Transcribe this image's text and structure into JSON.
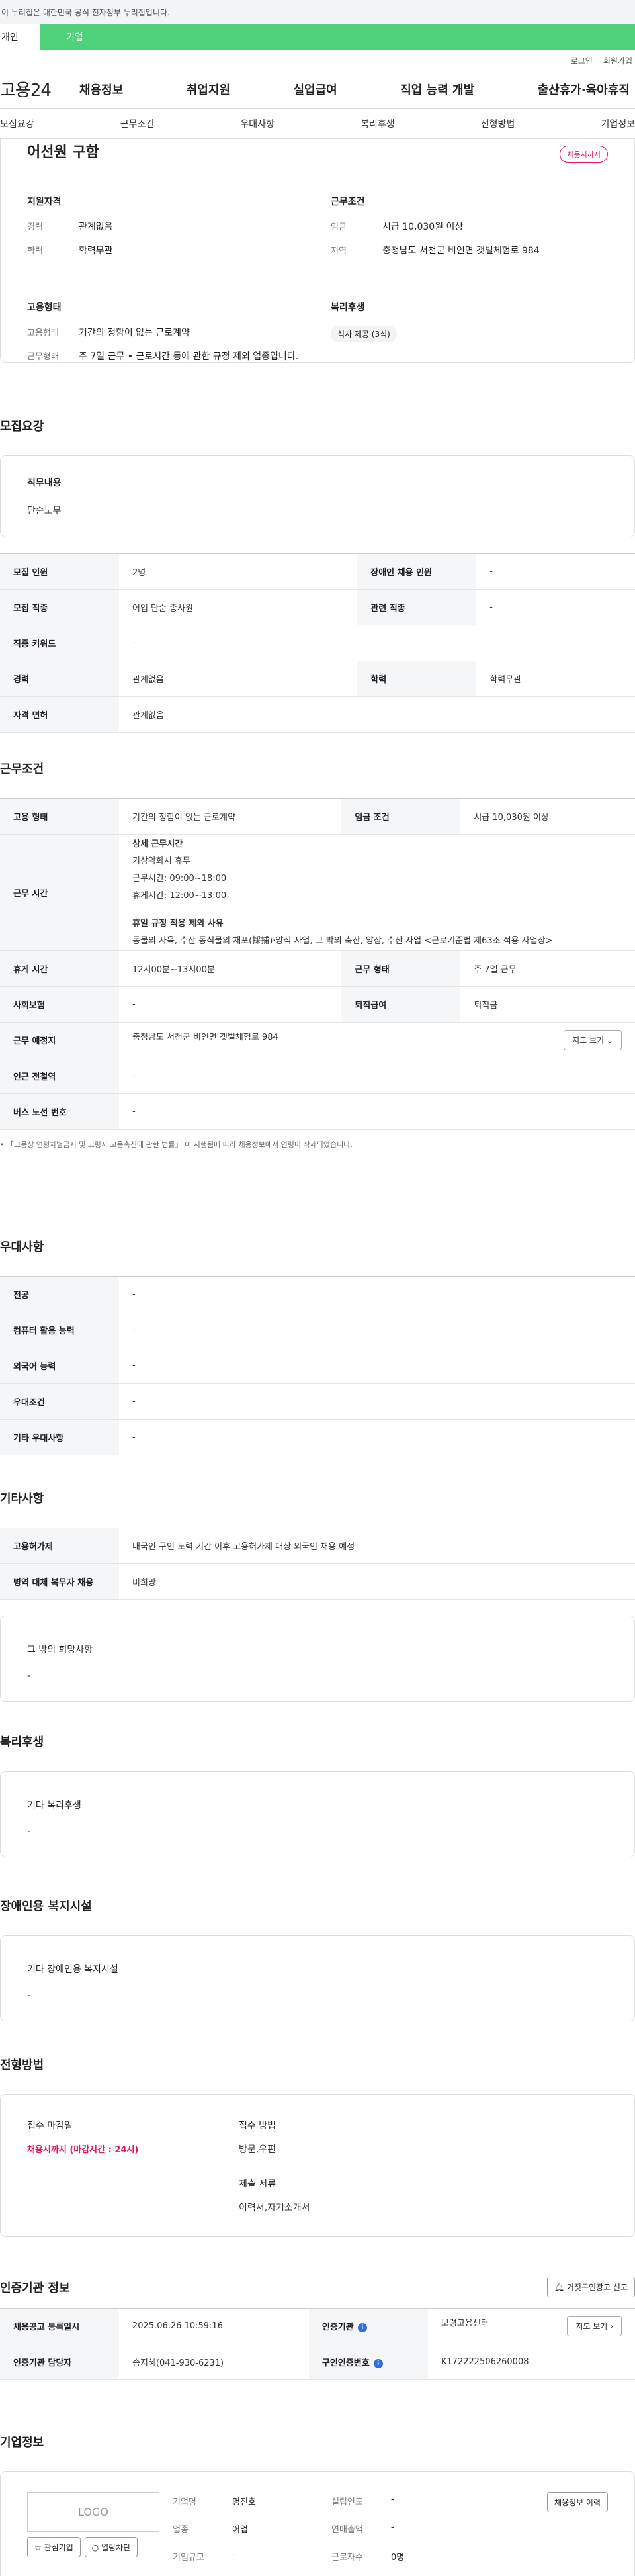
{
  "banner": "이 누리집은 대한민국 공식 전자정부 누리집입니다.",
  "user_tabs": [
    "개인",
    "기업"
  ],
  "util": [
    "로그인",
    "회원가입"
  ],
  "logo": "고용24",
  "gnb": [
    "채용정보",
    "취업지원",
    "실업급여",
    "직업 능력 개발",
    "출산휴가·육아휴직"
  ],
  "anchor_tabs": [
    "모집요강",
    "근무조건",
    "우대사항",
    "복리후생",
    "전형방법",
    "기업정보"
  ],
  "summary": {
    "title": "어선원 구함",
    "badge": "채용시까지",
    "qual_head": "지원자격",
    "qual": [
      {
        "k": "경력",
        "v": "관계없음"
      },
      {
        "k": "학력",
        "v": "학력무관"
      }
    ],
    "cond_head": "근무조건",
    "cond": [
      {
        "k": "임금",
        "v": "시급 10,030원 이상"
      },
      {
        "k": "지역",
        "v": "충청남도 서천군 비인면 갯벌체험로 984"
      }
    ],
    "emp_head": "고용형태",
    "emp": [
      {
        "k": "고용형태",
        "v": "기간의 정함이 없는 근로계약"
      },
      {
        "k": "근무형태",
        "v": "주 7일 근무 • 근로시간 등에 관한 규정 제외 업종입니다."
      }
    ],
    "welfare_head": "복리후생",
    "welfare_chip": "식사 제공 (3식)"
  },
  "recruit": {
    "title": "모집요강",
    "duty_head": "직무내용",
    "duty_val": "단순노무",
    "rows": [
      {
        "k1": "모집 인원",
        "v1": "2명",
        "k2": "장애인 채용 인원",
        "v2": "-"
      },
      {
        "k1": "모집 직종",
        "v1": "어업 단순 종사원",
        "k2": "관련 직종",
        "v2": "-"
      },
      {
        "k1": "직종 키워드",
        "v1": "-"
      },
      {
        "k1": "경력",
        "v1": "관계없음",
        "k2": "학력",
        "v2": "학력무관"
      },
      {
        "k1": "자격 면허",
        "v1": "관계없음"
      }
    ]
  },
  "work": {
    "title": "근무조건",
    "emp_k": "고용 형태",
    "emp_v": "기간의 정함이 없는 근로계약",
    "pay_k": "임금 조건",
    "pay_v": "시급 10,030원 이상",
    "time_k": "근무 시간",
    "time_head": "상세 근무시간",
    "time_lines": [
      "기상악화시 휴무",
      "근무시간: 09:00~18:00",
      "휴게시간: 12:00~13:00"
    ],
    "except_head": "휴일 규정 적용 제외 사유",
    "except_val": "동물의 사육, 수산 동식물의 채포(採捕)·양식 사업, 그 밖의 축산, 양잠, 수산 사업 <근로기준법 제63조 적용 사업장>",
    "rest_k": "휴게 시간",
    "rest_v": "12시00분~13시00분",
    "form_k": "근무 형태",
    "form_v": "주 7일 근무",
    "ins_k": "사회보험",
    "ins_v": "-",
    "ret_k": "퇴직급여",
    "ret_v": "퇴직금",
    "place_k": "근무 예정지",
    "place_v": "충청남도 서천군 비인면 갯벌체험로 984",
    "map_btn": "지도 보기",
    "sub_k": "인근 전철역",
    "sub_v": "-",
    "bus_k": "버스 노선 번호",
    "bus_v": "-",
    "note": "「고용상 연령차별금지 및 고령자 고용촉진에 관한 법률」 이 시행됨에 따라 채용정보에서 연령이 삭제되었습니다."
  },
  "pref": {
    "title": "우대사항",
    "rows": [
      {
        "k": "전공",
        "v": "-"
      },
      {
        "k": "컴퓨터 활용 능력",
        "v": "-"
      },
      {
        "k": "외국어 능력",
        "v": "-"
      },
      {
        "k": "우대조건",
        "v": "-"
      },
      {
        "k": "기타 우대사항",
        "v": "-"
      }
    ]
  },
  "etc": {
    "title": "기타사항",
    "rows": [
      {
        "k": "고용허가제",
        "v": "내국인 구인 노력 기간 이후 고용허가제 대상 외국인 채용 예정"
      },
      {
        "k": "병역 대체 복무자 채용",
        "v": "비희망"
      }
    ],
    "box_head": "그 밖의 희망사항",
    "box_val": "-"
  },
  "welfare": {
    "title": "복리후생",
    "head": "기타 복리후생",
    "val": "-"
  },
  "disabled": {
    "title": "장애인용 복지시설",
    "head": "기타 장애인용 복지시설",
    "val": "-"
  },
  "process": {
    "title": "전형방법",
    "deadline_head": "접수 마감일",
    "deadline_val": "채용시까지 (마감시간 : 24시)",
    "method_head": "접수 방법",
    "method_val": "방문,우편",
    "docs_head": "제출 서류",
    "docs_val": "이력서,자기소개서"
  },
  "agency": {
    "title": "인증기관 정보",
    "report_btn": "거짓구인광고 신고",
    "reg_k": "채용공고 등록일시",
    "reg_v": "2025.06.26 10:59:16",
    "org_k": "인증기관",
    "org_v": "보령고용센터",
    "map_btn": "지도 보기",
    "mgr_k": "인증기관 담당자",
    "mgr_v": "송지혜(041-930-6231)",
    "num_k": "구인인증번호",
    "num_v": "K172222506260008"
  },
  "company": {
    "title": "기업정보",
    "logo": "LOGO",
    "fav_btn": "관심기업",
    "block_btn": "열람차단",
    "rows": [
      {
        "k1": "기업명",
        "v1": "명진호",
        "k2": "설립연도",
        "v2": "-"
      },
      {
        "k1": "업종",
        "v1": "어업",
        "k2": "연매출액",
        "v2": "-"
      },
      {
        "k1": "기업규모",
        "v1": "-",
        "k2": "근로자수",
        "v2": "0명"
      }
    ],
    "history_btn": "채용정보 이력"
  }
}
